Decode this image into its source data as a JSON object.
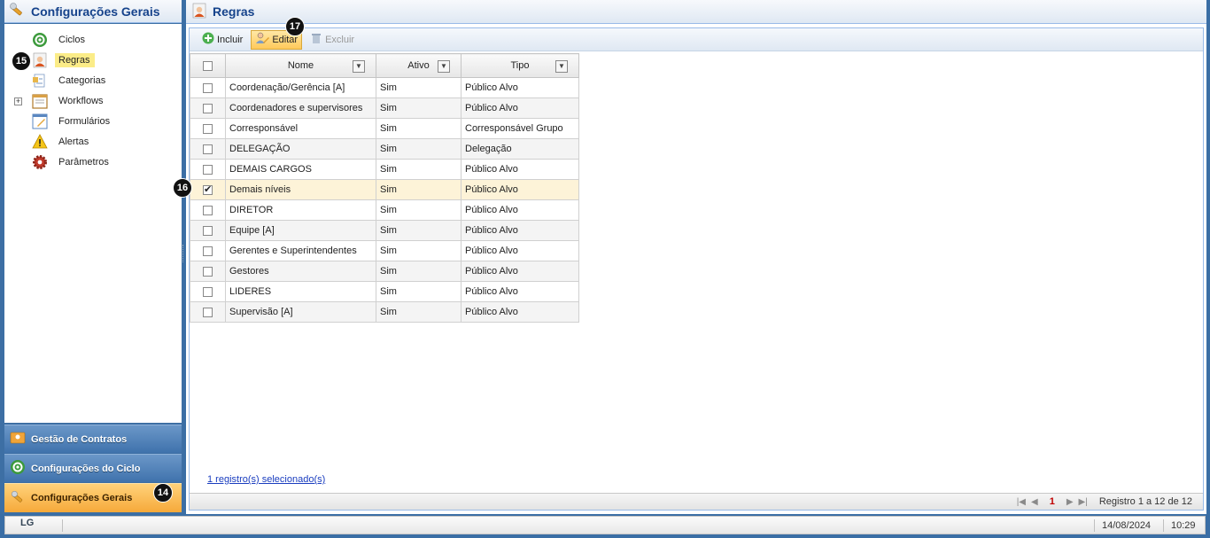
{
  "left_panel": {
    "title": "Configurações Gerais",
    "tree": [
      {
        "label": "Ciclos",
        "icon": "cycle-icon",
        "expandable": false,
        "selected": false
      },
      {
        "label": "Regras",
        "icon": "user-rule-icon",
        "expandable": false,
        "selected": true
      },
      {
        "label": "Categorias",
        "icon": "document-icon",
        "expandable": false,
        "selected": false
      },
      {
        "label": "Workflows",
        "icon": "workflow-icon",
        "expandable": true,
        "selected": false
      },
      {
        "label": "Formulários",
        "icon": "form-icon",
        "expandable": false,
        "selected": false
      },
      {
        "label": "Alertas",
        "icon": "warning-icon",
        "expandable": false,
        "selected": false
      },
      {
        "label": "Parâmetros",
        "icon": "gear-icon",
        "expandable": false,
        "selected": false
      }
    ],
    "accordion": [
      {
        "label": "Gestão de Contratos",
        "icon": "contracts-icon",
        "active": false
      },
      {
        "label": "Configurações do Ciclo",
        "icon": "cycle-icon",
        "active": false
      },
      {
        "label": "Configurações Gerais",
        "icon": "tools-icon",
        "active": true
      }
    ]
  },
  "main": {
    "title": "Regras",
    "toolbar": {
      "include_label": "Incluir",
      "edit_label": "Editar",
      "delete_label": "Excluir"
    },
    "grid": {
      "columns": [
        "Nome",
        "Ativo",
        "Tipo"
      ],
      "rows": [
        {
          "nome": "Coordenação/Gerência [A]",
          "ativo": "Sim",
          "tipo": "Público Alvo",
          "checked": false
        },
        {
          "nome": "Coordenadores e supervisores",
          "ativo": "Sim",
          "tipo": "Público Alvo",
          "checked": false
        },
        {
          "nome": "Corresponsável",
          "ativo": "Sim",
          "tipo": "Corresponsável Grupo",
          "checked": false
        },
        {
          "nome": "DELEGAÇÃO",
          "ativo": "Sim",
          "tipo": "Delegação",
          "checked": false
        },
        {
          "nome": "DEMAIS CARGOS",
          "ativo": "Sim",
          "tipo": "Público Alvo",
          "checked": false
        },
        {
          "nome": "Demais níveis",
          "ativo": "Sim",
          "tipo": "Público Alvo",
          "checked": true
        },
        {
          "nome": "DIRETOR",
          "ativo": "Sim",
          "tipo": "Público Alvo",
          "checked": false
        },
        {
          "nome": "Equipe [A]",
          "ativo": "Sim",
          "tipo": "Público Alvo",
          "checked": false
        },
        {
          "nome": "Gerentes e Superintendentes",
          "ativo": "Sim",
          "tipo": "Público Alvo",
          "checked": false
        },
        {
          "nome": "Gestores",
          "ativo": "Sim",
          "tipo": "Público Alvo",
          "checked": false
        },
        {
          "nome": "LIDERES",
          "ativo": "Sim",
          "tipo": "Público Alvo",
          "checked": false
        },
        {
          "nome": "Supervisão [A]",
          "ativo": "Sim",
          "tipo": "Público Alvo",
          "checked": false
        }
      ]
    },
    "selection_text": "1 registro(s) selecionado(s)",
    "pager": {
      "current_page": "1",
      "info": "Registro 1 a 12 de 12"
    }
  },
  "status_bar": {
    "logo": "LG",
    "date": "14/08/2024",
    "time": "10:29"
  },
  "markers": [
    "14",
    "15",
    "16",
    "17"
  ],
  "colors": {
    "accent": "#15428b",
    "selection": "#fbec88",
    "frame": "#3d6fa4",
    "active_accordion": "#f6a93a"
  }
}
